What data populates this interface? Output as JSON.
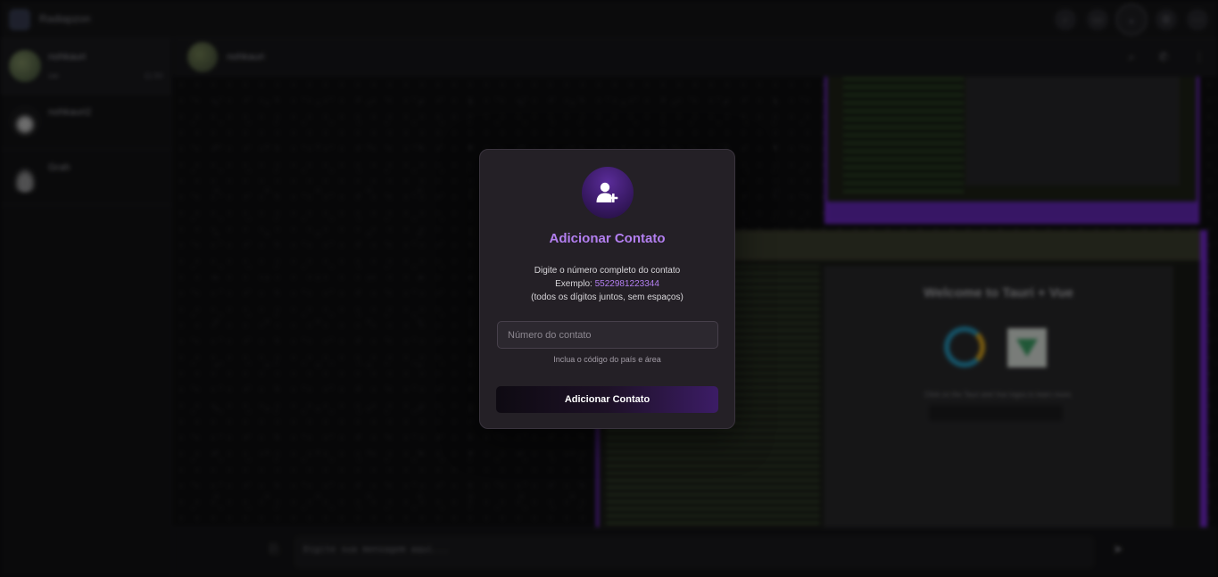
{
  "app": {
    "title": "Radiapzon"
  },
  "topbar": {
    "icons": [
      "search-icon",
      "video-icon",
      "add-contact-icon",
      "settings-icon",
      "more-icon"
    ]
  },
  "sidebar": {
    "chats": [
      {
        "name": "nohkauri",
        "snippet": "oie",
        "time": "11:50"
      },
      {
        "name": "nohkauri2",
        "snippet": "",
        "time": ""
      },
      {
        "name": "Grah",
        "snippet": "",
        "time": ""
      }
    ]
  },
  "chat": {
    "header": {
      "name": "nohkauri"
    },
    "image_app": {
      "welcome": "Welcome to Tauri + Vue",
      "sub": "Click on the Tauri and Vue logos to learn more.",
      "button": "Greet"
    }
  },
  "composer": {
    "placeholder": "Digite sua mensagem aqui..."
  },
  "modal": {
    "title": "Adicionar Contato",
    "desc_line1": "Digite o número completo do contato",
    "example_label": "Exemplo: ",
    "example_number": "5522981223344",
    "desc_line3": "(todos os dígitos juntos, sem espaços)",
    "input_placeholder": "Número do contato",
    "input_value": "",
    "hint": "Inclua o código do país e área",
    "button_label": "Adicionar Contato",
    "accent_color": "#b37ff0",
    "icon": "add-user-icon"
  }
}
